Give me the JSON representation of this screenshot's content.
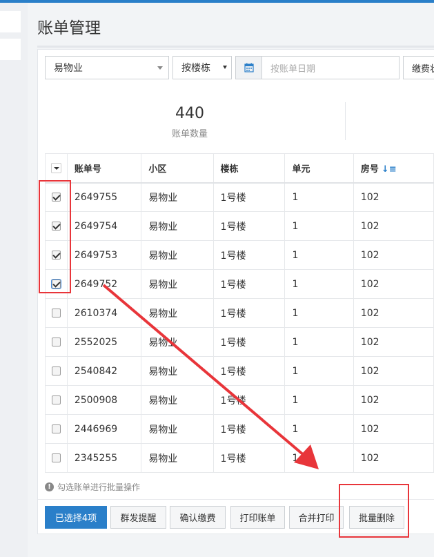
{
  "page": {
    "title": "账单管理"
  },
  "filters": {
    "community": "易物业",
    "building": "按楼栋",
    "date_placeholder": "按账单日期",
    "status": "缴费状"
  },
  "stats": {
    "count": "440",
    "count_label": "账单数量"
  },
  "table": {
    "headers": [
      "账单号",
      "小区",
      "楼栋",
      "单元",
      "房号"
    ],
    "rows": [
      {
        "checked": true,
        "id": "2649755",
        "community": "易物业",
        "building": "1号楼",
        "unit": "1",
        "room": "102"
      },
      {
        "checked": true,
        "id": "2649754",
        "community": "易物业",
        "building": "1号楼",
        "unit": "1",
        "room": "102"
      },
      {
        "checked": true,
        "id": "2649753",
        "community": "易物业",
        "building": "1号楼",
        "unit": "1",
        "room": "102"
      },
      {
        "checked": true,
        "id": "2649752",
        "community": "易物业",
        "building": "1号楼",
        "unit": "1",
        "room": "102"
      },
      {
        "checked": false,
        "id": "2610374",
        "community": "易物业",
        "building": "1号楼",
        "unit": "1",
        "room": "102"
      },
      {
        "checked": false,
        "id": "2552025",
        "community": "易物业",
        "building": "1号楼",
        "unit": "1",
        "room": "102"
      },
      {
        "checked": false,
        "id": "2540842",
        "community": "易物业",
        "building": "1号楼",
        "unit": "1",
        "room": "102"
      },
      {
        "checked": false,
        "id": "2500908",
        "community": "易物业",
        "building": "1号楼",
        "unit": "1",
        "room": "102"
      },
      {
        "checked": false,
        "id": "2446969",
        "community": "易物业",
        "building": "1号楼",
        "unit": "1",
        "room": "102"
      },
      {
        "checked": false,
        "id": "2345255",
        "community": "易物业",
        "building": "1号楼",
        "unit": "1",
        "room": "102"
      }
    ]
  },
  "hint": "勾选账单进行批量操作",
  "actions": {
    "selected": "已选择4项",
    "remind": "群发提醒",
    "confirm": "确认缴费",
    "print": "打印账单",
    "merge_print": "合并打印",
    "batch_delete": "批量删除"
  },
  "colors": {
    "primary": "#2a7fc9",
    "annotation": "#e8353a"
  }
}
